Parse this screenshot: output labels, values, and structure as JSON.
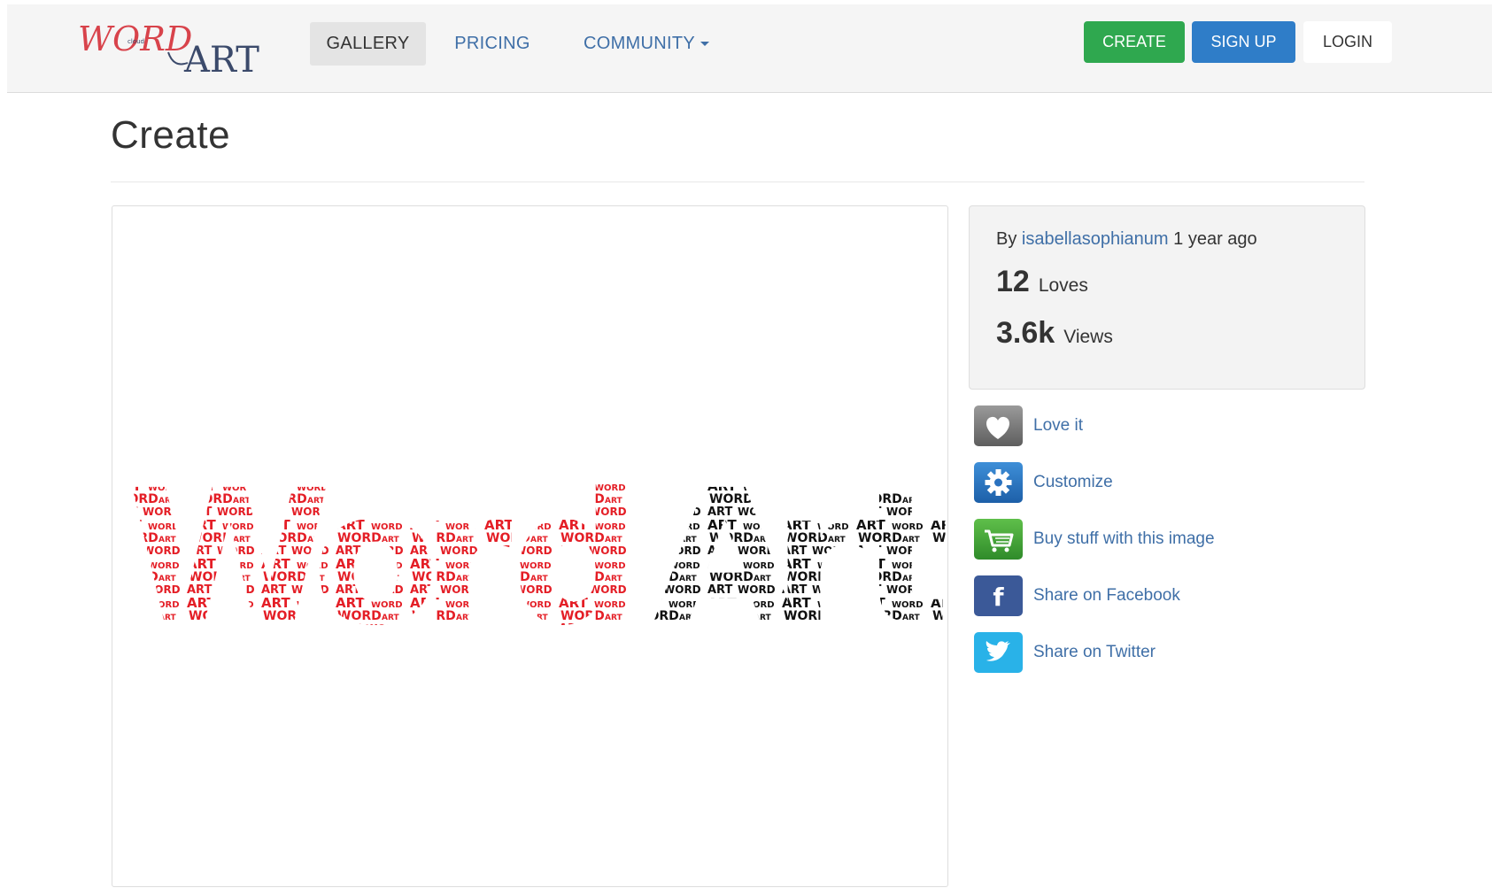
{
  "logo": {
    "text_word": "WORD",
    "text_art": "ART",
    "text_cloud": "cloud"
  },
  "nav": {
    "gallery": "GALLERY",
    "pricing": "PRICING",
    "community": "COMMUNITY"
  },
  "buttons": {
    "create": "CREATE",
    "signup": "SIGN UP",
    "login": "LOGIN"
  },
  "page": {
    "title": "Create"
  },
  "artwork": {
    "letters_red": [
      "W",
      "o",
      "r",
      "d"
    ],
    "letters_black": [
      "A",
      "r",
      "t"
    ],
    "words": [
      "WORD",
      "ART"
    ],
    "colors": {
      "red": "#e41e26",
      "black": "#111111"
    }
  },
  "info": {
    "by_prefix": "By",
    "author": "isabellasophianum",
    "time": "1 year ago",
    "loves_count": "12",
    "loves_label": "Loves",
    "views_count": "3.6k",
    "views_label": "Views"
  },
  "actions": [
    {
      "icon": "heart-icon",
      "label": "Love it"
    },
    {
      "icon": "gear-icon",
      "label": "Customize"
    },
    {
      "icon": "cart-icon",
      "label": "Buy stuff with this image"
    },
    {
      "icon": "facebook-icon",
      "label": "Share on Facebook"
    },
    {
      "icon": "twitter-icon",
      "label": "Share on Twitter"
    }
  ],
  "colors": {
    "link": "#3f6fa7",
    "create_button": "#2fa84f",
    "signup_button": "#2f7dc8",
    "logo_red": "#d8434b",
    "logo_blue": "#3b4a6b"
  }
}
